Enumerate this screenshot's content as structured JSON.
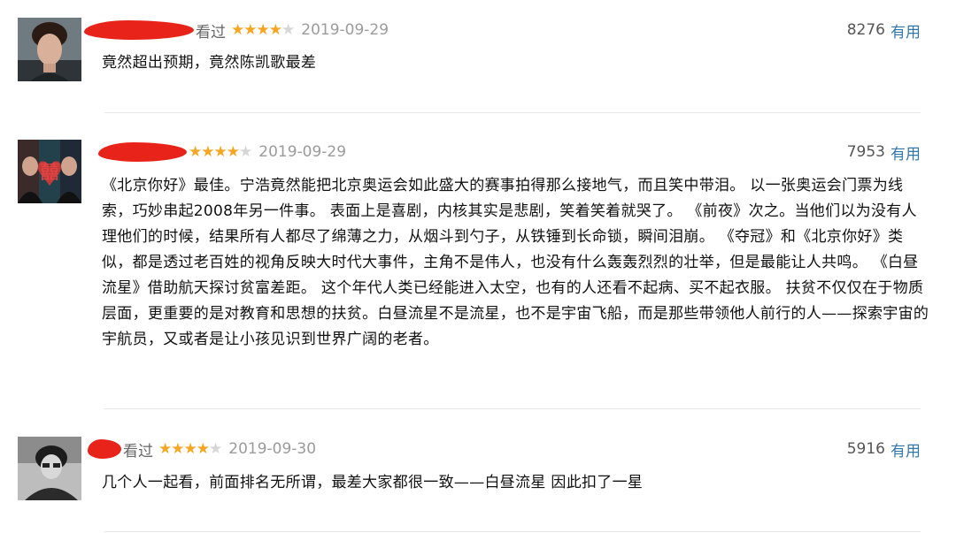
{
  "comments": [
    {
      "status": "看过",
      "rating": 4,
      "date": "2019-09-29",
      "votes": "8276",
      "useful_label": "有用",
      "text": "竟然超出预期，竟然陈凯歌最差",
      "avatar": "avatar-man-curly-hair"
    },
    {
      "status": "",
      "rating": 4,
      "date": "2019-09-29",
      "votes": "7953",
      "useful_label": "有用",
      "text": "《北京你好》最佳。宁浩竟然能把北京奥运会如此盛大的赛事拍得那么接地气，而且笑中带泪。 以一张奥运会门票为线索，巧妙串起2008年另一件事。 表面上是喜剧，内核其实是悲剧，笑着笑着就哭了。 《前夜》次之。当他们以为没有人理他们的时候，结果所有人都尽了绵薄之力，从烟斗到勺子，从铁锤到长命锁，瞬间泪崩。 《夺冠》和《北京你好》类似，都是透过老百姓的视角反映大时代大事件，主角不是伟人，也没有什么轰轰烈烈的壮举，但是最能让人共鸣。 《白昼流星》借助航天探讨贫富差距。 这个年代人类已经能进入太空，也有的人还看不起病、买不起衣服。 扶贫不仅仅在于物质层面，更重要的是对教育和思想的扶贫。白昼流星不是流星，也不是宇宙飞船，而是那些带领他人前行的人——探索宇宙的宇航员，又或者是让小孩见识到世界广阔的老者。",
      "avatar": "avatar-double-happiness"
    },
    {
      "status": "看过",
      "rating": 4,
      "date": "2019-09-30",
      "votes": "5916",
      "useful_label": "有用",
      "text": "几个人一起看，前面排名无所谓，最差大家都很一致——白昼流星 因此扣了一星",
      "avatar": "avatar-bw-portrait"
    }
  ],
  "colors": {
    "redaction": "#e8241a",
    "star_on": "#f5a623",
    "star_off": "#d6d6d6",
    "link": "#3377aa"
  }
}
